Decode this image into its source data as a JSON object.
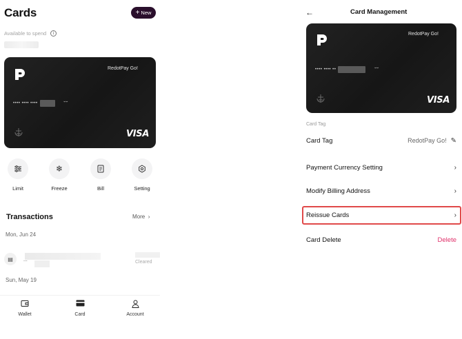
{
  "left_screen": {
    "title": "Cards",
    "new_button": {
      "icon": "plus-icon",
      "label": "New"
    },
    "available_label": "Available to spend",
    "card": {
      "brand_name": "RedotPay Go!",
      "number_prefix": "•••• •••• ••••",
      "network": "VISA"
    },
    "actions": [
      {
        "label": "Limit",
        "icon": "sliders-icon"
      },
      {
        "label": "Freeze",
        "icon": "snowflake-icon"
      },
      {
        "label": "Bill",
        "icon": "document-icon"
      },
      {
        "label": "Setting",
        "icon": "gear-icon"
      }
    ],
    "transactions": {
      "title": "Transactions",
      "more_label": "More",
      "groups": [
        {
          "date": "Mon, Jun 24",
          "items": [
            {
              "status": "Cleared",
              "icon": "card-receipt-icon",
              "prefix": "..."
            }
          ]
        },
        {
          "date": "Sun, May 19",
          "items": []
        }
      ]
    },
    "bottom_nav": [
      {
        "label": "Wallet",
        "icon": "wallet-icon"
      },
      {
        "label": "Card",
        "icon": "card-icon",
        "active": true
      },
      {
        "label": "Account",
        "icon": "person-icon"
      }
    ]
  },
  "right_screen": {
    "title": "Card Management",
    "card": {
      "brand_name": "RedotPay Go!",
      "number_prefix": "•••• •••• ••",
      "network": "VISA"
    },
    "card_tag_section_label": "Card Tag",
    "rows": {
      "card_tag": {
        "label": "Card Tag",
        "value": "RedotPay Go!"
      },
      "payment_currency": {
        "label": "Payment Currency Setting"
      },
      "billing_address": {
        "label": "Modify Billing Address"
      },
      "reissue": {
        "label": "Reissue Cards",
        "highlighted": true
      },
      "card_delete": {
        "label": "Card Delete",
        "action": "Delete"
      }
    },
    "colors": {
      "delete": "#e0306a",
      "highlight": "#e04848"
    }
  }
}
